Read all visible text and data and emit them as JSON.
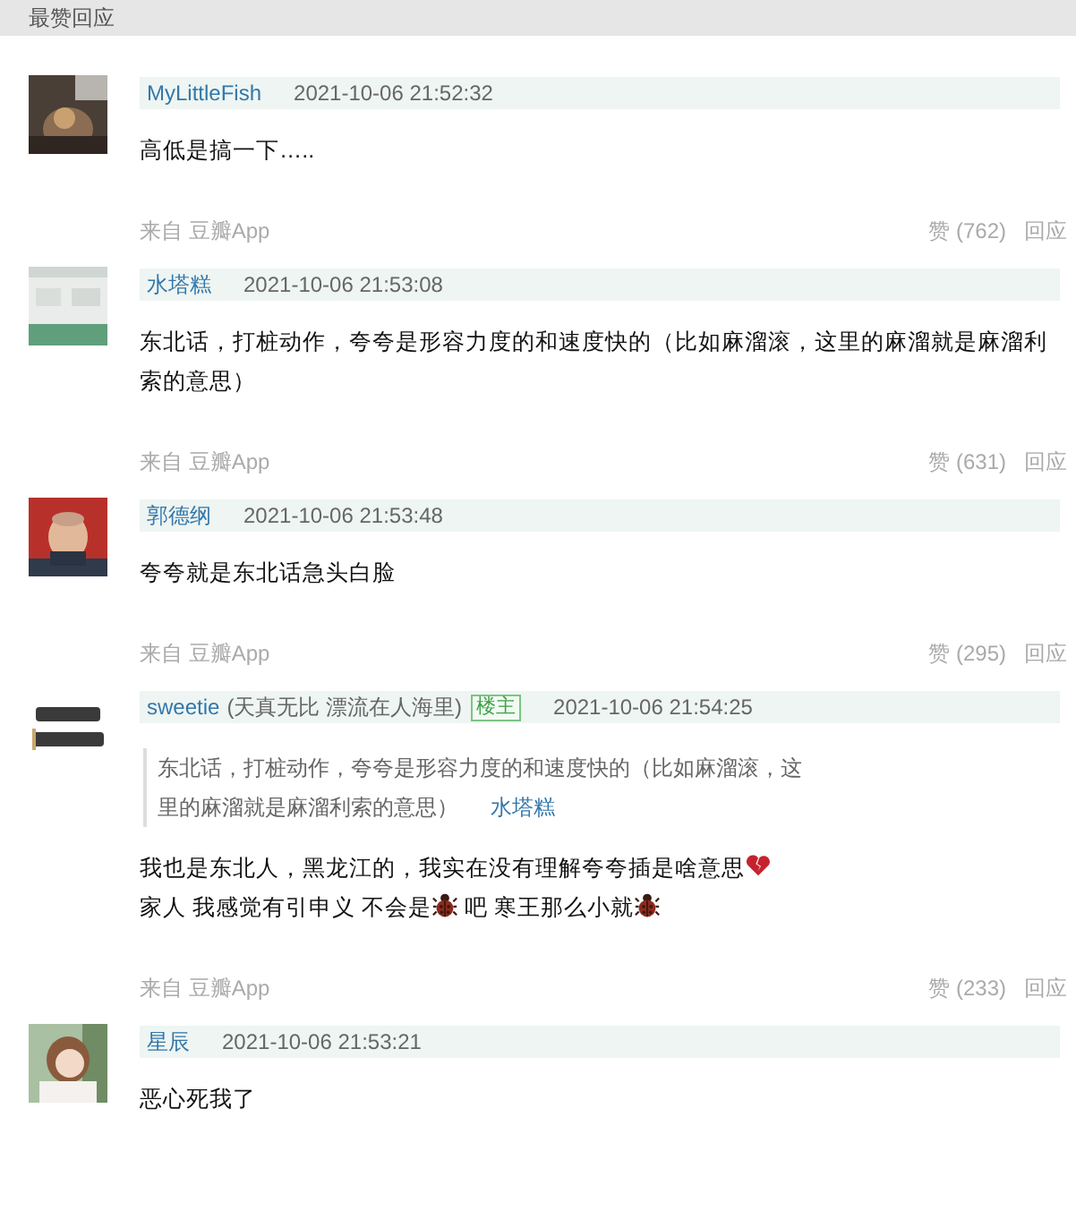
{
  "section_title": "最赞回应",
  "comments": [
    {
      "author": "MyLittleFish",
      "time": "2021-10-06 21:52:32",
      "lines": [
        [
          {
            "kind": "text",
            "text": "高低是搞一下….."
          }
        ]
      ],
      "source": "来自 豆瓣App",
      "likes": "赞 (762)",
      "reply": "回应"
    },
    {
      "author": "水塔糕",
      "time": "2021-10-06 21:53:08",
      "lines": [
        [
          {
            "kind": "text",
            "text": "东北话，打桩动作，夸夸是形容力度的和速度快的（比如麻溜滚，这里的麻溜就是麻溜利索的意思）"
          }
        ]
      ],
      "source": "来自 豆瓣App",
      "likes": "赞 (631)",
      "reply": "回应"
    },
    {
      "author": "郭德纲",
      "time": "2021-10-06 21:53:48",
      "lines": [
        [
          {
            "kind": "text",
            "text": "夸夸就是东北话急头白脸"
          }
        ]
      ],
      "source": "来自 豆瓣App",
      "likes": "赞 (295)",
      "reply": "回应"
    },
    {
      "author": "sweetie",
      "signature": "(天真无比 漂流在人海里)",
      "badge": "楼主",
      "time": "2021-10-06 21:54:25",
      "quote": {
        "text": "东北话，打桩动作，夸夸是形容力度的和速度快的（比如麻溜滚，这里的麻溜就是麻溜利索的意思）",
        "author": "水塔糕"
      },
      "lines": [
        [
          {
            "kind": "text",
            "text": "我也是东北人，黑龙江的，我实在没有理解夸夸插是啥意思"
          },
          {
            "kind": "broken-heart"
          }
        ],
        [
          {
            "kind": "text",
            "text": "家人 我感觉有引申义 不会是"
          },
          {
            "kind": "bug"
          },
          {
            "kind": "text",
            "text": " 吧 寒王那么小就"
          },
          {
            "kind": "bug"
          }
        ]
      ],
      "source": "来自 豆瓣App",
      "likes": "赞 (233)",
      "reply": "回应"
    },
    {
      "author": "星辰",
      "time": "2021-10-06 21:53:21",
      "lines": [
        [
          {
            "kind": "text",
            "text": "恶心死我了"
          }
        ]
      ]
    }
  ]
}
